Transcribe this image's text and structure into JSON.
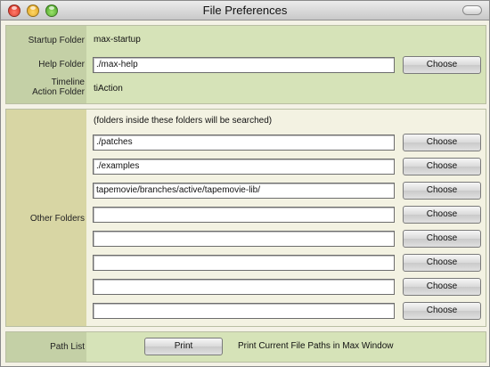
{
  "window": {
    "title": "File Preferences"
  },
  "startup": {
    "label": "Startup Folder",
    "value": "max-startup"
  },
  "help": {
    "label": "Help Folder",
    "value": "./max-help",
    "button": "Choose"
  },
  "timeline": {
    "label_line1": "Timeline",
    "label_line2": "Action Folder",
    "value": "tiAction"
  },
  "other": {
    "label": "Other Folders",
    "note": "(folders inside these folders will be searched)",
    "rows": [
      {
        "value": "./patches",
        "button": "Choose"
      },
      {
        "value": "./examples",
        "button": "Choose"
      },
      {
        "value": "tapemovie/branches/active/tapemovie-lib/",
        "button": "Choose"
      },
      {
        "value": "",
        "button": "Choose"
      },
      {
        "value": "",
        "button": "Choose"
      },
      {
        "value": "",
        "button": "Choose"
      },
      {
        "value": "",
        "button": "Choose"
      },
      {
        "value": "",
        "button": "Choose"
      }
    ]
  },
  "pathlist": {
    "label": "Path List",
    "button": "Print",
    "description": "Print Current File Paths in Max Window"
  }
}
